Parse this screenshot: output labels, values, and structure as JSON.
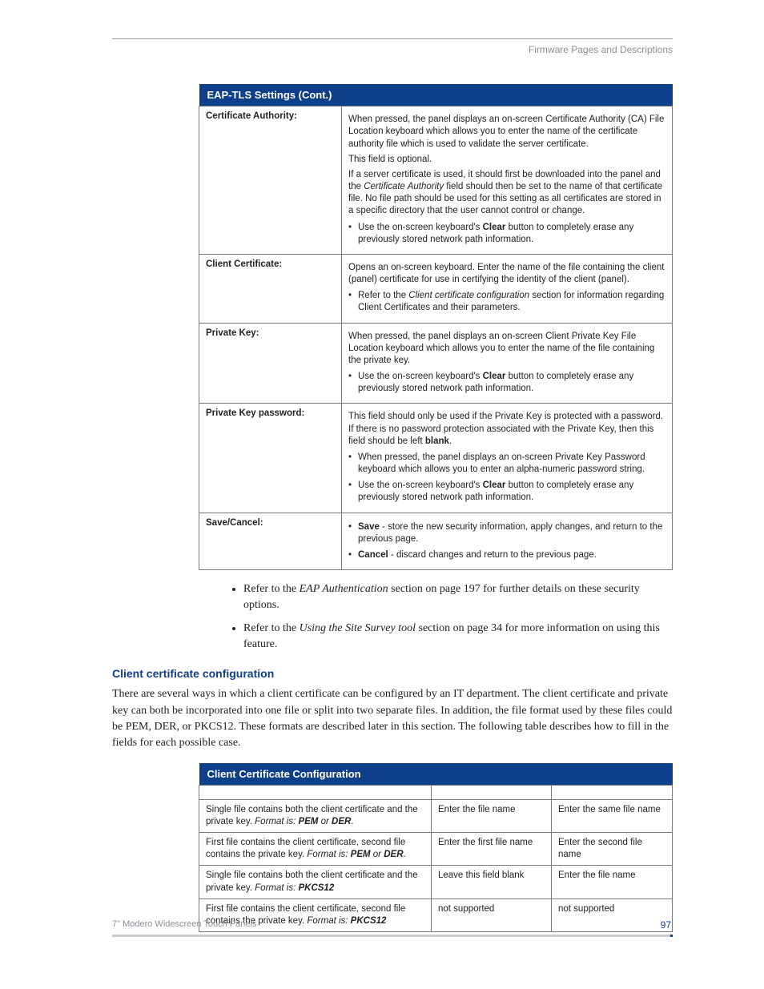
{
  "runningHead": "Firmware Pages and Descriptions",
  "table1": {
    "title": "EAP-TLS Settings (Cont.)",
    "rows": {
      "ca": {
        "label": "Certificate Authority:",
        "p1": "When pressed, the panel displays an on-screen Certificate Authority (CA) File Location keyboard which allows you to enter the name of the certificate authority file which is used to validate the server certificate.",
        "p2": "This field is optional.",
        "p3a": "If a server certificate is used, it should first be downloaded into the panel and the ",
        "p3b": "Certificate Authority",
        "p3c": " field should then be set to the name of that certificate file. No file path should be used for this setting as all certificates are stored in a specific directory that the user cannot control or change.",
        "b1a": "Use the on-screen keyboard's ",
        "b1b": "Clear",
        "b1c": " button to completely erase any previously stored network path information."
      },
      "cc": {
        "label": "Client Certificate:",
        "p1": "Opens an on-screen keyboard. Enter the name of the file containing the client (panel) certificate for use in certifying the identity of the client (panel).",
        "b1a": "Refer to the ",
        "b1b": "Client certificate configuration",
        "b1c": " section for information regarding Client Certificates and their parameters."
      },
      "pk": {
        "label": "Private Key:",
        "p1": "When pressed, the panel displays an on-screen Client Private Key File Location keyboard which allows you to enter the name of the file containing the private key.",
        "b1a": "Use the on-screen keyboard's ",
        "b1b": "Clear",
        "b1c": " button to completely erase any previously stored network path information."
      },
      "pkp": {
        "label": "Private Key password:",
        "p1a": "This field should only be used if the Private Key is protected with a password. If there is no password protection associated with the Private Key, then this field should be left ",
        "p1b": "blank",
        "p1c": ".",
        "b1": "When pressed, the panel displays an on-screen Private Key Password keyboard which allows you to enter an alpha-numeric password string.",
        "b2a": "Use the on-screen keyboard's ",
        "b2b": "Clear",
        "b2c": " button to completely erase any previously stored network path information."
      },
      "sc": {
        "label": "Save/Cancel:",
        "b1a": "Save",
        "b1b": " - store the new security information, apply changes, and return to the previous page.",
        "b2a": "Cancel",
        "b2b": " - discard changes and return to the previous page."
      }
    }
  },
  "bullets": {
    "b1a": "Refer to the ",
    "b1b": "EAP Authentication",
    "b1c": " section on page 197 for further details on these security options.",
    "b2a": "Refer to the ",
    "b2b": "Using the Site Survey tool",
    "b2c": " section on page 34 for more information on using this feature."
  },
  "subhead": "Client certificate configuration",
  "para": "There are several ways in which a client certificate can be configured by an IT department. The client certificate and private key can both be incorporated into one file or split into two separate files. In addition, the file format used by these files could be PEM, DER, or PKCS12. These formats are described later in this section. The following table describes how to fill in the fields for each possible case.",
  "table2": {
    "title": "Client Certificate Configuration",
    "r1": {
      "c1a": "Single file contains both the client certificate and the private key. ",
      "c1b": "Format is: ",
      "c1c": "PEM",
      "c1d": " or ",
      "c1e": "DER",
      "c1f": ".",
      "c2": "Enter the file name",
      "c3": "Enter the same file name"
    },
    "r2": {
      "c1a": "First file contains the client certificate, second file contains the private key. ",
      "c1b": "Format is: ",
      "c1c": "PEM",
      "c1d": " or ",
      "c1e": "DER",
      "c1f": ".",
      "c2": "Enter the first file name",
      "c3": "Enter the second file name"
    },
    "r3": {
      "c1a": "Single file contains both the client certificate and the private key. ",
      "c1b": "Format is: ",
      "c1c": "PKCS12",
      "c2": "Leave this field blank",
      "c3": "Enter the file name"
    },
    "r4": {
      "c1a": "First file contains the client certificate, second file contains the private key. ",
      "c1b": "Format is: ",
      "c1c": "PKCS12",
      "c2": "not supported",
      "c3": "not supported"
    }
  },
  "footer": {
    "left": "7\" Modero Widescreen Touch Panels",
    "page": "97"
  }
}
